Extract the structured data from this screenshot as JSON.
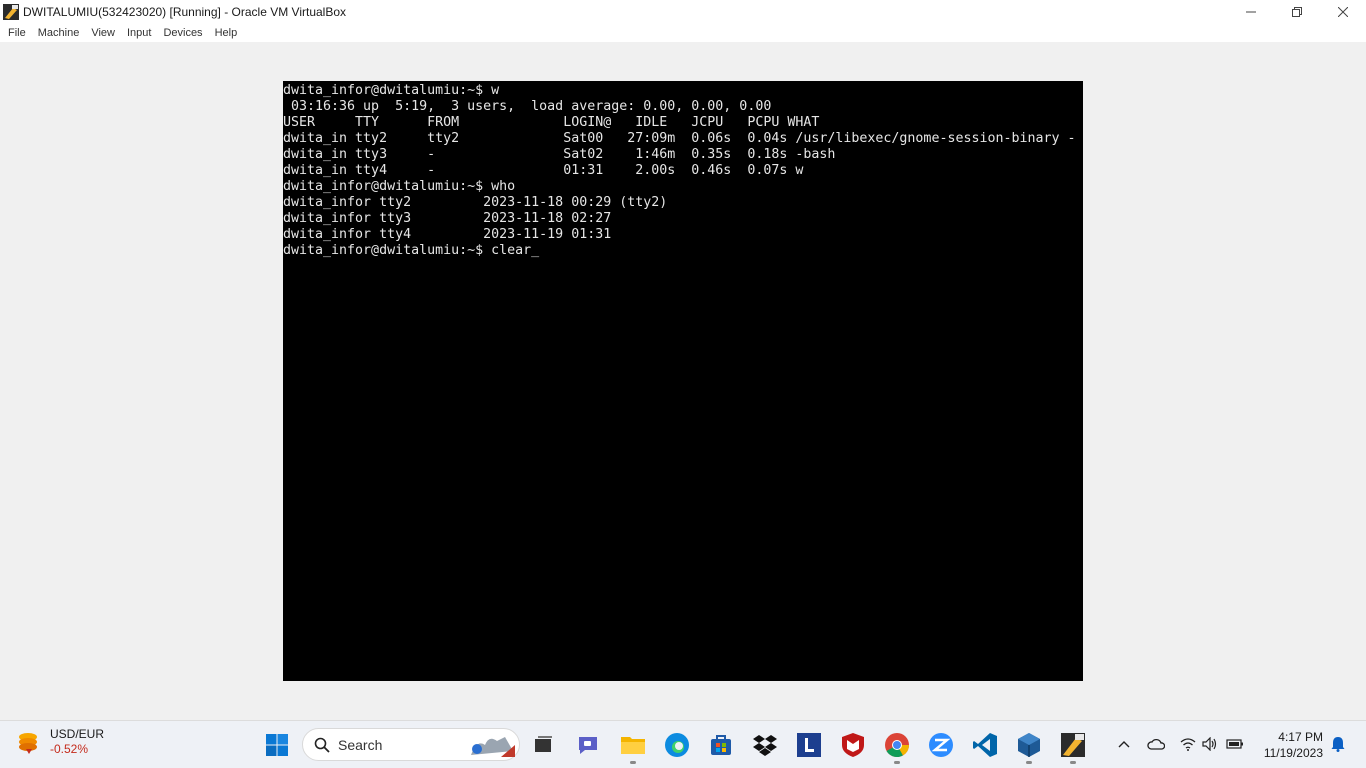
{
  "window": {
    "title": "DWITALUMIU(532423020) [Running] - Oracle VM VirtualBox"
  },
  "menubar": {
    "items": [
      "File",
      "Machine",
      "View",
      "Input",
      "Devices",
      "Help"
    ]
  },
  "console": {
    "lines": [
      "dwita_infor@dwitalumiu:~$ w",
      " 03:16:36 up  5:19,  3 users,  load average: 0.00, 0.00, 0.00",
      "USER     TTY      FROM             LOGIN@   IDLE   JCPU   PCPU WHAT",
      "dwita_in tty2     tty2             Sat00   27:09m  0.06s  0.04s /usr/libexec/gnome-session-binary -",
      "dwita_in tty3     -                Sat02    1:46m  0.35s  0.18s -bash",
      "dwita_in tty4     -                01:31    2.00s  0.46s  0.07s w",
      "dwita_infor@dwitalumiu:~$ who",
      "dwita_infor tty2         2023-11-18 00:29 (tty2)",
      "dwita_infor tty3         2023-11-18 02:27",
      "dwita_infor tty4         2023-11-19 01:31"
    ],
    "prompt": "dwita_infor@dwitalumiu:~$ ",
    "current_input": "clear",
    "cursor": "_"
  },
  "taskbar": {
    "widget": {
      "title": "USD/EUR",
      "change": "-0.52%",
      "change_color": "#c42b1c",
      "icon": "currency-chart-icon"
    },
    "search_label": "Search",
    "pinned": [
      "windows-start-icon",
      "search-icon",
      "task-view-icon",
      "teams-chat-icon",
      "file-explorer-icon",
      "edge-icon",
      "microsoft-store-icon",
      "dropbox-icon",
      "l-app-icon",
      "mcafee-icon",
      "chrome-icon",
      "zoom-icon",
      "vscode-icon",
      "virtualbox-icon",
      "virtualbox-vm-icon"
    ],
    "tray": [
      "chevron-up-icon",
      "onedrive-icon",
      "wifi-icon",
      "volume-icon",
      "battery-icon",
      "notification-bell-icon"
    ],
    "clock": {
      "time": "4:17 PM",
      "date": "11/19/2023"
    }
  }
}
